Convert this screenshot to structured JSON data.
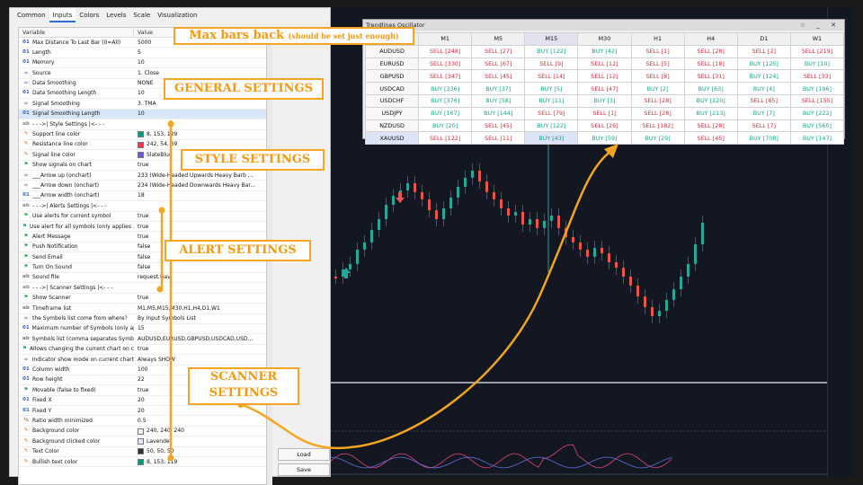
{
  "tabs": [
    "Common",
    "Inputs",
    "Colors",
    "Levels",
    "Scale",
    "Visualization"
  ],
  "active_tab": "Inputs",
  "grid": {
    "col_variable": "Variable",
    "col_value": "Value",
    "rows": [
      {
        "icon": "01",
        "type": "num",
        "name": "Max Distance To Last Bar (0=All)",
        "value": "5000"
      },
      {
        "icon": "01",
        "type": "num",
        "name": "Length",
        "value": "5"
      },
      {
        "icon": "01",
        "type": "num",
        "name": "Memory",
        "value": "10"
      },
      {
        "icon": "⚌",
        "type": "list",
        "name": "Source",
        "value": "1. Close"
      },
      {
        "icon": "⚌",
        "type": "list",
        "name": "Data Smoothing",
        "value": "NONE"
      },
      {
        "icon": "01",
        "type": "num",
        "name": "Data Smoothing Length",
        "value": "10"
      },
      {
        "icon": "⚌",
        "type": "list",
        "name": "Signal Smoothing",
        "value": "3. TMA"
      },
      {
        "icon": "01",
        "type": "num",
        "name": "Signal Smoothing Length",
        "value": "10",
        "sel": true
      },
      {
        "icon": "ab",
        "type": "sep",
        "name": "- - ->| Style Settings |<- - -",
        "value": ""
      },
      {
        "icon": "✎",
        "type": "color",
        "name": "Support line color",
        "value": "8, 153, 129",
        "swatch": "#089981"
      },
      {
        "icon": "✎",
        "type": "color",
        "name": "Resistance line color",
        "value": "242, 54, 69",
        "swatch": "#f23645"
      },
      {
        "icon": "✎",
        "type": "color",
        "name": "Signal line color",
        "value": "SlateBlue",
        "swatch": "#6a5acd"
      },
      {
        "icon": "⚑",
        "type": "flag",
        "name": "Show signals on chart",
        "value": "true"
      },
      {
        "icon": "⚌",
        "type": "list",
        "name": "___Arrow up (onchart)",
        "value": "233 (Wide-Headed Upwards Heavy Barb ..."
      },
      {
        "icon": "⚌",
        "type": "list",
        "name": "___Arrow down (onchart)",
        "value": "234 (Wide-Headed Downwards Heavy Bar..."
      },
      {
        "icon": "01",
        "type": "num",
        "name": "___Arrow width (onchart)",
        "value": "18"
      },
      {
        "icon": "ab",
        "type": "sep",
        "name": "- - ->| Alerts Settings |<- - -",
        "value": ""
      },
      {
        "icon": "⚑",
        "type": "flag",
        "name": "Use alerts for current symbol",
        "value": "true"
      },
      {
        "icon": "⚑",
        "type": "flag",
        "name": "Use alert for all symbols (only applies ...",
        "value": "true"
      },
      {
        "icon": "⚑",
        "type": "flag",
        "name": "Alert Message",
        "value": "true"
      },
      {
        "icon": "⚑",
        "type": "flag",
        "name": "Push Notification",
        "value": "false"
      },
      {
        "icon": "⚑",
        "type": "flag",
        "name": "Send Email",
        "value": "false"
      },
      {
        "icon": "⚑",
        "type": "flag",
        "name": "Turn On Sound",
        "value": "false"
      },
      {
        "icon": "ab",
        "type": "text",
        "name": "Sound file",
        "value": "request.wav"
      },
      {
        "icon": "ab",
        "type": "sep",
        "name": "- - ->| Scanner Settings |<- - -",
        "value": ""
      },
      {
        "icon": "⚑",
        "type": "flag",
        "name": "Show Scanner",
        "value": "true"
      },
      {
        "icon": "ab",
        "type": "text",
        "name": "Timeframe list",
        "value": "M1,M5,M15,M30,H1,H4,D1,W1"
      },
      {
        "icon": "⚌",
        "type": "list",
        "name": "the Symbols list come from where?",
        "value": "By Input Symbols List"
      },
      {
        "icon": "01",
        "type": "num",
        "name": "Maximum number of Symbols (only ap...",
        "value": "15"
      },
      {
        "icon": "ab",
        "type": "text",
        "name": "Symbols list (comma separates Symbol...",
        "value": "AUDUSD,EURUSD,GBPUSD,USDCAD,USD..."
      },
      {
        "icon": "⚑",
        "type": "flag",
        "name": "Allows changing the current chart on c...",
        "value": "true"
      },
      {
        "icon": "⚌",
        "type": "list",
        "name": "Indicator show mode on current chart",
        "value": "Always SHOW"
      },
      {
        "icon": "01",
        "type": "num",
        "name": "Column width",
        "value": "100"
      },
      {
        "icon": "01",
        "type": "num",
        "name": "Row height",
        "value": "22"
      },
      {
        "icon": "⚑",
        "type": "flag",
        "name": "Movable (false to fixed)",
        "value": "true"
      },
      {
        "icon": "01",
        "type": "num",
        "name": "Fixed X",
        "value": "20"
      },
      {
        "icon": "01",
        "type": "num",
        "name": "Fixed Y",
        "value": "20"
      },
      {
        "icon": "½",
        "type": "ratio",
        "name": "Ratio width minimized",
        "value": "0.5"
      },
      {
        "icon": "✎",
        "type": "color",
        "name": "Background color",
        "value": "240, 240, 240",
        "swatch": "#f0f0f0"
      },
      {
        "icon": "✎",
        "type": "color",
        "name": "Background clicked color",
        "value": "Lavender",
        "swatch": "#e6e6fa"
      },
      {
        "icon": "✎",
        "type": "color",
        "name": "Text Color",
        "value": "50, 50, 50",
        "swatch": "#323232"
      },
      {
        "icon": "✎",
        "type": "color",
        "name": "Bullish text color",
        "value": "8, 153, 119",
        "swatch": "#089977"
      }
    ]
  },
  "buttons": {
    "load": "Load",
    "save": "Save"
  },
  "scanner": {
    "title": "Trendlines Oscillator",
    "controls": "☆ _ ✕",
    "timeframes": [
      "M1",
      "M5",
      "M15",
      "M30",
      "H1",
      "H4",
      "D1",
      "W1"
    ],
    "active_col": "M15",
    "active_row": "XAUUSD",
    "rows": [
      {
        "symbol": "AUDUSD",
        "cells": [
          "SELL [248]",
          "SELL [27]",
          "BUY [122]",
          "BUY [42]",
          "SELL [1]",
          "SELL [28]",
          "SELL [2]",
          "SELL [219]"
        ]
      },
      {
        "symbol": "EURUSD",
        "cells": [
          "SELL [330]",
          "SELL [67]",
          "SELL [9]",
          "SELL [12]",
          "SELL [5]",
          "SELL [18]",
          "BUY [125]",
          "BUY [10]"
        ]
      },
      {
        "symbol": "GBPUSD",
        "cells": [
          "SELL [347]",
          "SELL [45]",
          "SELL [14]",
          "SELL [12]",
          "SELL [8]",
          "SELL [31]",
          "BUY [124]",
          "SELL [33]"
        ]
      },
      {
        "symbol": "USDCAD",
        "cells": [
          "BUY [336]",
          "BUY [37]",
          "BUY [5]",
          "SELL [47]",
          "BUY [2]",
          "BUY [63]",
          "BUY [4]",
          "BUY [196]"
        ]
      },
      {
        "symbol": "USDCHF",
        "cells": [
          "BUY [376]",
          "BUY [58]",
          "BUY [11]",
          "BUY [3]",
          "SELL [28]",
          "BUY [120]",
          "SELL [85]",
          "SELL [155]"
        ]
      },
      {
        "symbol": "USDJPY",
        "cells": [
          "BUY [167]",
          "BUY [144]",
          "SELL [79]",
          "SELL [1]",
          "SELL [28]",
          "BUY [213]",
          "BUY [7]",
          "BUY [222]"
        ]
      },
      {
        "symbol": "NZDUSD",
        "cells": [
          "BUY [20]",
          "SELL [45]",
          "BUY [122]",
          "SELL [26]",
          "SELL [182]",
          "SELL [28]",
          "SELL [7]",
          "BUY [560]"
        ]
      },
      {
        "symbol": "XAUUSD",
        "cells": [
          "SELL [122]",
          "SELL [11]",
          "BUY [43]",
          "BUY [59]",
          "BUY [29]",
          "SELL [45]",
          "BUY [708]",
          "BUY [147]"
        ]
      }
    ]
  },
  "annotations": {
    "max_bars": "Max bars back",
    "max_bars_note": "(should be set just enough)",
    "general": "GENERAL SETTINGS",
    "style": "STYLE SETTINGS",
    "alert": "ALERT SETTINGS",
    "scanner_1": "SCANNER",
    "scanner_2": "SETTINGS"
  },
  "colors": {
    "accent": "#f4a521",
    "buy": "#14a78a",
    "sell": "#d22f3a",
    "chart_bg": "#131722"
  }
}
